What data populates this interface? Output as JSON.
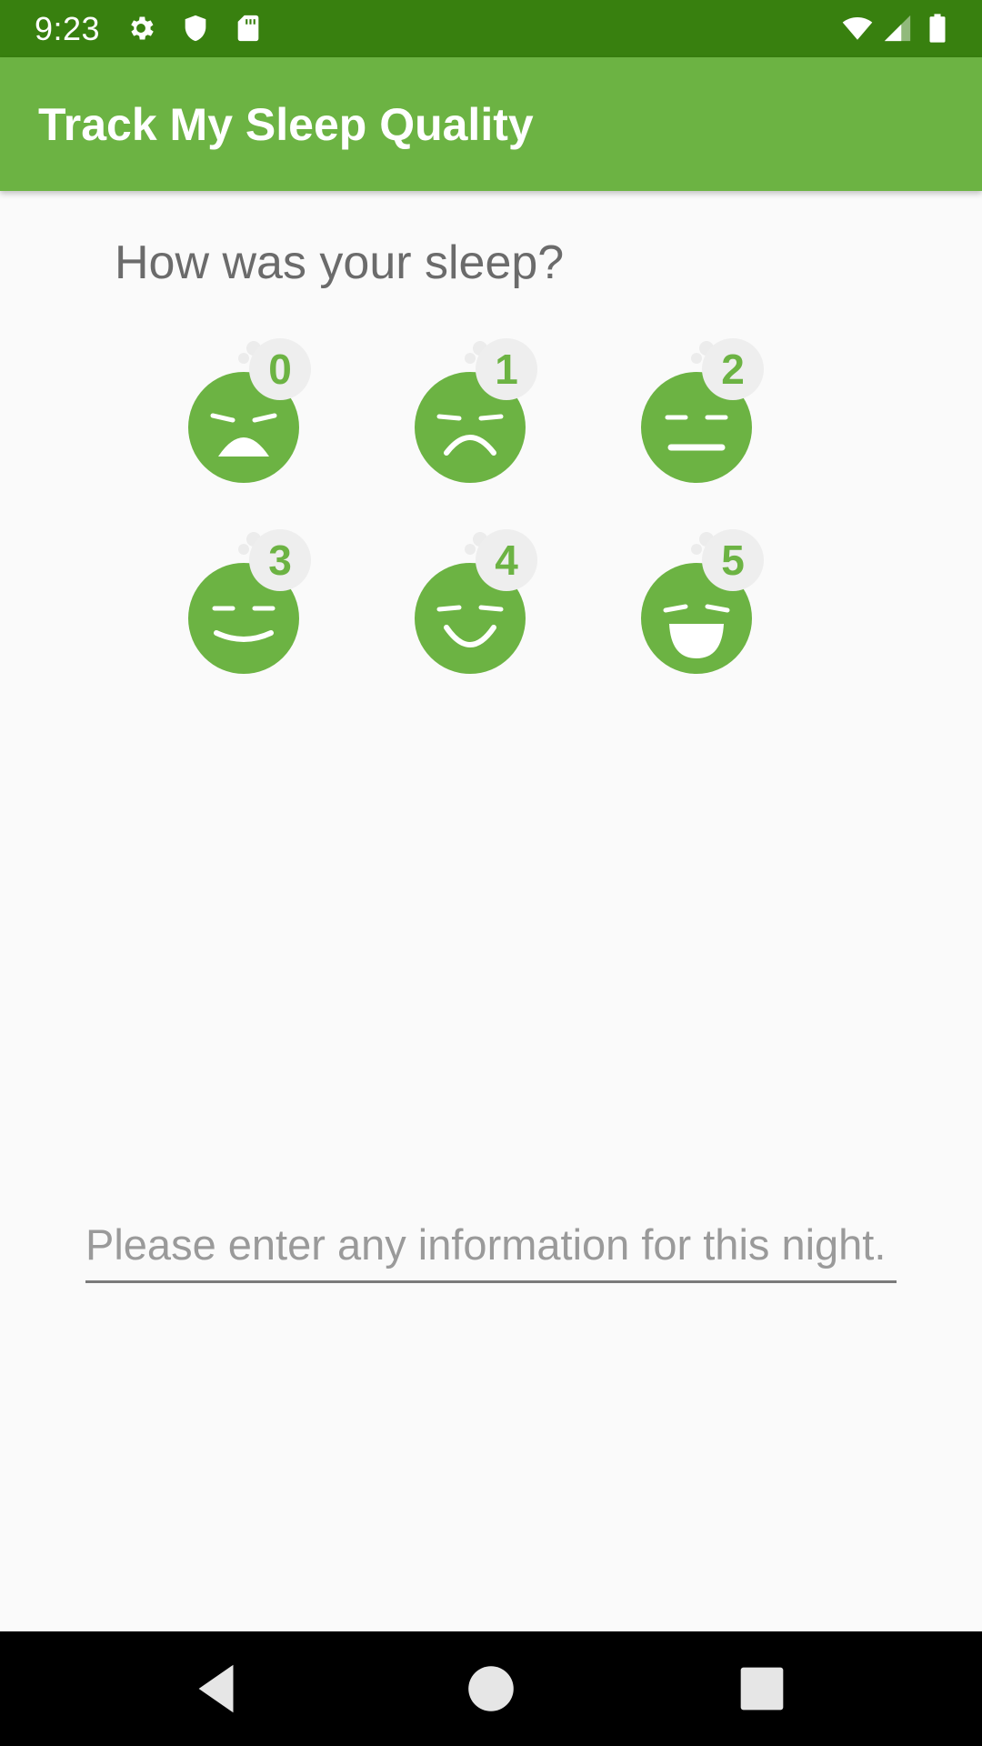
{
  "status_bar": {
    "time": "9:23",
    "left_icons": [
      "gear-icon",
      "shield-icon",
      "sd-card-icon"
    ],
    "right_icons": [
      "wifi-icon",
      "cell-signal-icon",
      "battery-icon"
    ]
  },
  "app_bar": {
    "title": "Track My Sleep Quality"
  },
  "main": {
    "question": "How was your sleep?",
    "ratings": [
      {
        "number": "0",
        "icon": "very-sad-face-icon"
      },
      {
        "number": "1",
        "icon": "sad-face-icon"
      },
      {
        "number": "2",
        "icon": "neutral-face-icon"
      },
      {
        "number": "3",
        "icon": "slight-smile-face-icon"
      },
      {
        "number": "4",
        "icon": "smile-face-icon"
      },
      {
        "number": "5",
        "icon": "laughing-face-icon"
      }
    ],
    "notes": {
      "placeholder": "Please enter any information for this night.",
      "value": ""
    }
  },
  "nav_bar": {
    "buttons": [
      "back-icon",
      "home-icon",
      "recents-icon"
    ]
  },
  "colors": {
    "status_bar": "#38800f",
    "app_bar": "#6cb343",
    "accent": "#6cb343",
    "background": "#fafafa"
  }
}
